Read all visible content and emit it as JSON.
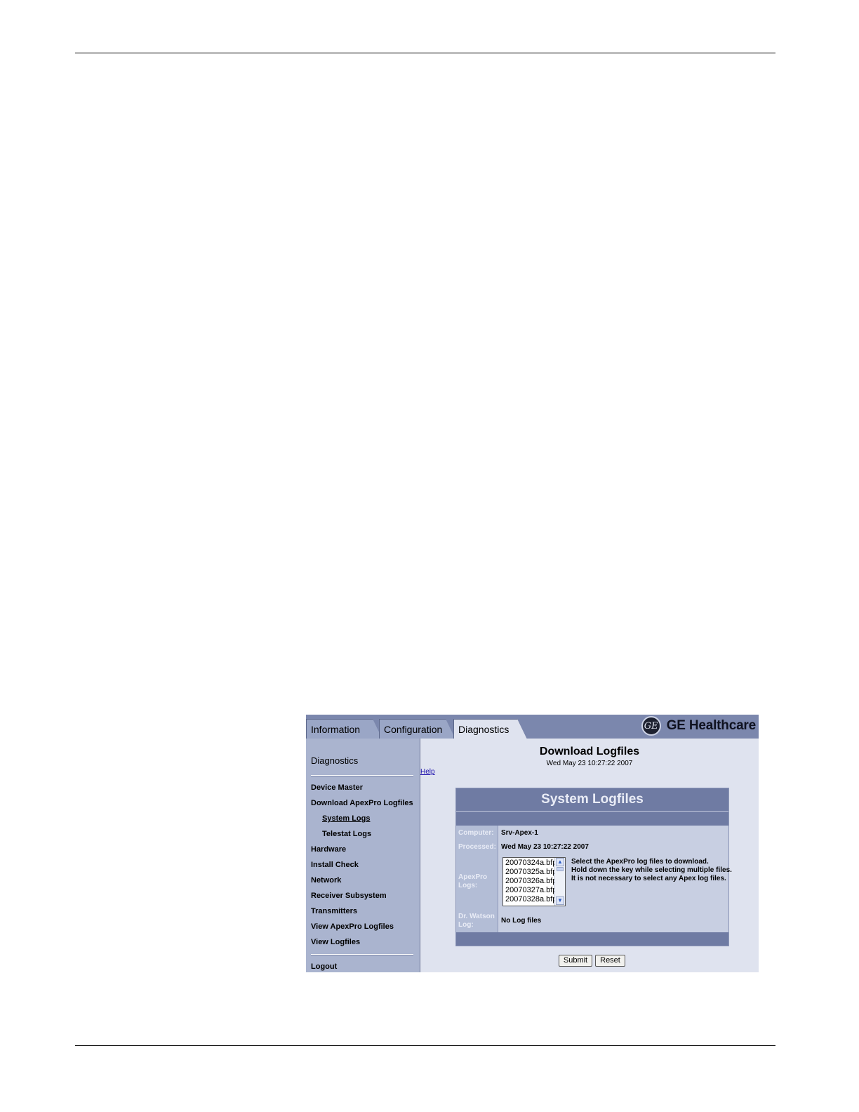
{
  "tabs": [
    {
      "label": "Information",
      "active": false
    },
    {
      "label": "Configuration",
      "active": false
    },
    {
      "label": "Diagnostics",
      "active": true
    }
  ],
  "brand": {
    "logo_text": "GE",
    "name": "GE Healthcare"
  },
  "sidebar": {
    "title": "Diagnostics",
    "items": [
      {
        "label": "Device Master"
      },
      {
        "label": "Download ApexPro Logfiles"
      },
      {
        "label": "System Logs"
      },
      {
        "label": "Telestat Logs"
      },
      {
        "label": "Hardware"
      },
      {
        "label": "Install Check"
      },
      {
        "label": "Network"
      },
      {
        "label": "Receiver Subsystem"
      },
      {
        "label": "Transmitters"
      },
      {
        "label": "View ApexPro Logfiles"
      },
      {
        "label": "View Logfiles"
      }
    ],
    "logout": "Logout"
  },
  "content": {
    "title": "Download Logfiles",
    "date": "Wed May 23 10:27:22 2007",
    "help": "Help"
  },
  "panel": {
    "title": "System Logfiles",
    "computer_label": "Computer:",
    "computer_value": "Srv-Apex-1",
    "processed_label": "Processed:",
    "processed_value": "Wed May 23 10:27:22 2007",
    "apexpro_label_1": "ApexPro",
    "apexpro_label_2": "Logs:",
    "log_files": [
      "20070324a.bfp",
      "20070325a.bfp",
      "20070326a.bfp",
      "20070327a.bfp",
      "20070328a.bfp"
    ],
    "hint_lines": [
      "Select the ApexPro log files to download.",
      "Hold down the key while selecting multiple files.",
      "It is not necessary to select any Apex log files."
    ],
    "watson_label_1": "Dr. Watson",
    "watson_label_2": "Log:",
    "watson_value": "No Log files"
  },
  "buttons": {
    "submit": "Submit",
    "reset": "Reset"
  },
  "colors": {
    "tabbar": "#7b87ad",
    "sidebar": "#aab4cf",
    "panel_header": "#6f7ba3",
    "content_bg": "#dfe3ef"
  }
}
